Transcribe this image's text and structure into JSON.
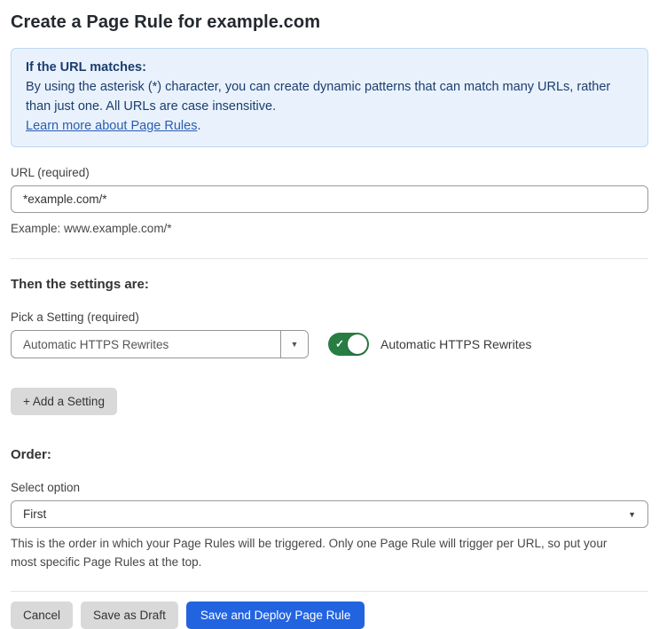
{
  "page": {
    "title": "Create a Page Rule for example.com"
  },
  "info_box": {
    "heading": "If the URL matches:",
    "body": "By using the asterisk (*) character, you can create dynamic patterns that can match many URLs, rather than just one. All URLs are case insensitive.",
    "link_label": "Learn more about Page Rules",
    "link_suffix": "."
  },
  "url_field": {
    "label": "URL (required)",
    "value": "*example.com/*",
    "helper": "Example: www.example.com/*"
  },
  "settings_section": {
    "heading": "Then the settings are:",
    "picker_label": "Pick a Setting (required)",
    "picker_value": "Automatic HTTPS Rewrites",
    "dropdown_arrow": "▼",
    "toggle_state": "on",
    "toggle_check": "✓",
    "toggle_label": "Automatic HTTPS Rewrites",
    "add_setting_label": "+ Add a Setting"
  },
  "order_section": {
    "heading": "Order:",
    "select_label": "Select option",
    "select_value": "First",
    "dropdown_arrow": "▼",
    "helper": "This is the order in which your Page Rules will be triggered. Only one Page Rule will trigger per URL, so put your most specific Page Rules at the top."
  },
  "footer": {
    "cancel_label": "Cancel",
    "save_draft_label": "Save as Draft",
    "save_deploy_label": "Save and Deploy Page Rule"
  },
  "colors": {
    "info_background": "#e9f2fc",
    "info_border": "#bcd8f3",
    "info_text": "#1b3d6e",
    "link_blue": "#2a5db0",
    "toggle_green": "#287d43",
    "primary_button_blue": "#2264e0",
    "gray_button": "#d9d9d9"
  }
}
